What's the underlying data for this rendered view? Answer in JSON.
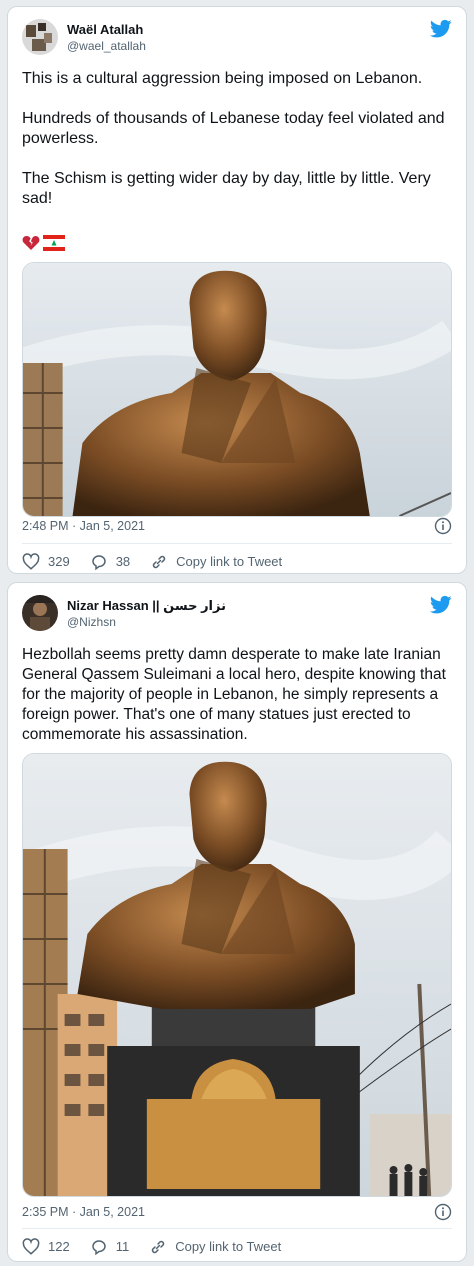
{
  "tweets": [
    {
      "author_name": "Waël Atallah",
      "author_handle": "@wael_atallah",
      "text": "This is a cultural aggression being imposed on Lebanon.\n\nHundreds of thousands of Lebanese today feel violated and powerless.\n\nThe Schism is getting wider day by day, little by little. Very sad!",
      "emoji_icons": [
        "broken-heart-icon",
        "lebanon-flag-icon"
      ],
      "timestamp": "2:48 PM · Jan 5, 2021",
      "likes": "329",
      "replies": "38",
      "copy_link": "Copy link to Tweet"
    },
    {
      "author_name": "Nizar Hassan || نزار حسن",
      "author_handle": "@Nizhsn",
      "text": "Hezbollah seems pretty damn desperate to make late Iranian General Qassem Suleimani a local hero, despite knowing that for the majority of people in Lebanon, he simply represents a foreign power. That's one of many statues just erected to commemorate his assassination.",
      "timestamp": "2:35 PM · Jan 5, 2021",
      "likes": "122",
      "replies": "11",
      "copy_link": "Copy link to Tweet"
    }
  ],
  "colors": {
    "twitter_blue": "#1d9bf0",
    "bronze": "#8a5a2b",
    "sky": "#cfd8df"
  }
}
